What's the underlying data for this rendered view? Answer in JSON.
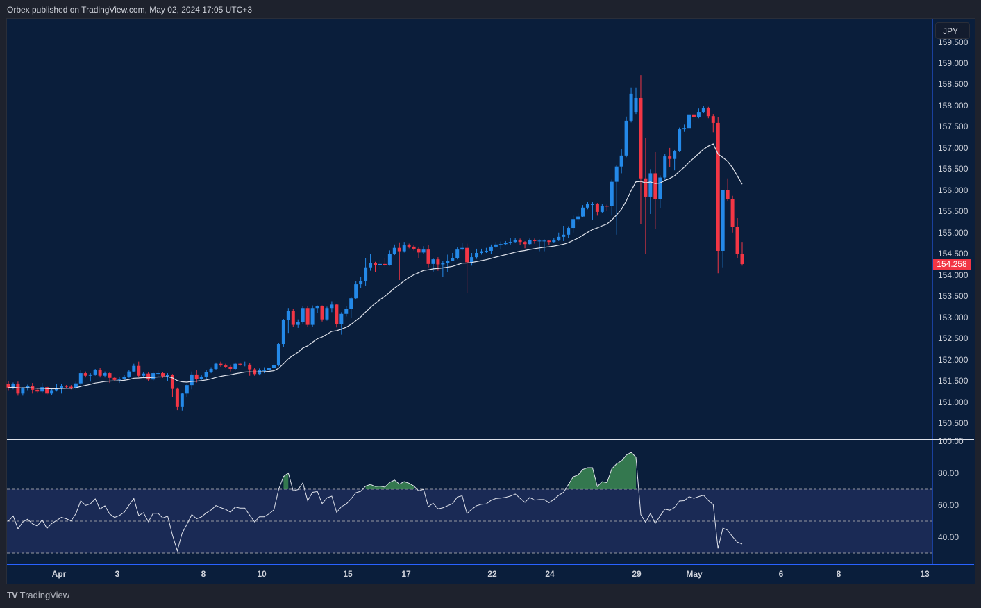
{
  "header": {
    "text": "Orbex published on TradingView.com, May 02, 2024 17:05 UTC+3"
  },
  "footer": {
    "brand": "TradingView",
    "logo_text": "TV"
  },
  "price_scale": {
    "currency": "JPY",
    "last_price": "154.258"
  },
  "colors": {
    "background": "#0a1e3b",
    "up": "#2489e8",
    "down": "#f23645",
    "ma_line": "#e0e3eb",
    "rsi_line": "#e0e3eb",
    "rsi_band": "#1a2a55",
    "rsi_overbought_fill": "#3f8f55",
    "last_price_label": "#f23645"
  },
  "chart_data": [
    {
      "type": "candlestick",
      "title": "",
      "y_ticks": [
        "159.500",
        "159.000",
        "158.500",
        "158.000",
        "157.500",
        "157.000",
        "156.500",
        "156.000",
        "155.500",
        "155.000",
        "154.500",
        "154.000",
        "153.500",
        "153.000",
        "152.500",
        "152.000",
        "151.500",
        "151.000",
        "150.500"
      ],
      "ylim": [
        150.3,
        159.55
      ],
      "x_ticks": [
        "Apr",
        "3",
        "8",
        "10",
        "15",
        "17",
        "22",
        "24",
        "29",
        "May",
        "6",
        "8",
        "13"
      ],
      "grid": false,
      "overlay": "moving average (white line)",
      "candles_ohlc": [
        [
          151.42,
          151.5,
          151.28,
          151.34
        ],
        [
          151.34,
          151.46,
          151.3,
          151.43
        ],
        [
          151.43,
          151.48,
          151.15,
          151.2
        ],
        [
          151.2,
          151.35,
          151.15,
          151.32
        ],
        [
          151.32,
          151.41,
          151.28,
          151.37
        ],
        [
          151.37,
          151.45,
          151.2,
          151.29
        ],
        [
          151.29,
          151.33,
          151.21,
          151.25
        ],
        [
          151.25,
          151.45,
          151.22,
          151.35
        ],
        [
          151.35,
          151.38,
          151.16,
          151.2
        ],
        [
          151.2,
          151.31,
          151.17,
          151.28
        ],
        [
          151.28,
          151.42,
          151.25,
          151.33
        ],
        [
          151.33,
          151.42,
          151.2,
          151.38
        ],
        [
          151.38,
          151.4,
          151.33,
          151.36
        ],
        [
          151.36,
          151.4,
          151.3,
          151.33
        ],
        [
          151.33,
          151.48,
          151.3,
          151.44
        ],
        [
          151.44,
          151.75,
          151.4,
          151.68
        ],
        [
          151.68,
          151.72,
          151.58,
          151.62
        ],
        [
          151.62,
          151.68,
          151.48,
          151.65
        ],
        [
          151.65,
          151.78,
          151.62,
          151.75
        ],
        [
          151.75,
          151.8,
          151.58,
          151.62
        ],
        [
          151.62,
          151.72,
          151.58,
          151.68
        ],
        [
          151.68,
          151.71,
          151.45,
          151.57
        ],
        [
          151.57,
          151.6,
          151.5,
          151.52
        ],
        [
          151.52,
          151.6,
          151.45,
          151.55
        ],
        [
          151.55,
          151.64,
          151.52,
          151.6
        ],
        [
          151.6,
          151.75,
          151.57,
          151.72
        ],
        [
          151.72,
          151.9,
          151.7,
          151.85
        ],
        [
          151.85,
          151.95,
          151.58,
          151.62
        ],
        [
          151.62,
          151.7,
          151.58,
          151.67
        ],
        [
          151.67,
          151.7,
          151.5,
          151.53
        ],
        [
          151.53,
          151.72,
          151.5,
          151.68
        ],
        [
          151.68,
          151.74,
          151.6,
          151.68
        ],
        [
          151.68,
          151.7,
          151.57,
          151.61
        ],
        [
          151.61,
          151.68,
          151.5,
          151.64
        ],
        [
          151.64,
          151.66,
          151.11,
          151.31
        ],
        [
          151.31,
          151.34,
          150.81,
          150.88
        ],
        [
          150.88,
          151.22,
          150.8,
          151.2
        ],
        [
          151.2,
          151.42,
          151.12,
          151.4
        ],
        [
          151.4,
          151.72,
          151.3,
          151.65
        ],
        [
          151.65,
          151.75,
          151.46,
          151.55
        ],
        [
          151.55,
          151.63,
          151.52,
          151.6
        ],
        [
          151.6,
          151.76,
          151.55,
          151.7
        ],
        [
          151.7,
          151.82,
          151.68,
          151.78
        ],
        [
          151.78,
          151.93,
          151.75,
          151.9
        ],
        [
          151.9,
          151.95,
          151.83,
          151.86
        ],
        [
          151.86,
          151.9,
          151.8,
          151.83
        ],
        [
          151.83,
          151.88,
          151.72,
          151.78
        ],
        [
          151.78,
          151.93,
          151.75,
          151.9
        ],
        [
          151.9,
          151.93,
          151.85,
          151.88
        ],
        [
          151.88,
          151.95,
          151.84,
          151.88
        ],
        [
          151.88,
          151.91,
          151.62,
          151.77
        ],
        [
          151.77,
          151.8,
          151.62,
          151.66
        ],
        [
          151.66,
          151.79,
          151.63,
          151.75
        ],
        [
          151.75,
          151.82,
          151.68,
          151.75
        ],
        [
          151.75,
          151.84,
          151.71,
          151.8
        ],
        [
          151.8,
          151.93,
          151.76,
          151.87
        ],
        [
          151.87,
          152.4,
          151.84,
          152.37
        ],
        [
          152.37,
          152.96,
          152.3,
          152.93
        ],
        [
          152.93,
          153.22,
          152.63,
          153.15
        ],
        [
          153.15,
          153.2,
          152.78,
          152.82
        ],
        [
          152.82,
          152.95,
          152.75,
          152.88
        ],
        [
          152.88,
          153.27,
          152.85,
          153.22
        ],
        [
          153.22,
          153.26,
          152.77,
          152.82
        ],
        [
          152.82,
          153.28,
          152.78,
          153.22
        ],
        [
          153.22,
          153.28,
          153.1,
          153.26
        ],
        [
          153.26,
          153.28,
          152.9,
          152.95
        ],
        [
          152.95,
          153.25,
          152.92,
          153.22
        ],
        [
          153.22,
          153.38,
          153.12,
          153.3
        ],
        [
          153.3,
          153.32,
          152.76,
          152.83
        ],
        [
          152.83,
          153.12,
          152.59,
          153.08
        ],
        [
          153.08,
          153.27,
          153.02,
          153.2
        ],
        [
          153.2,
          153.48,
          152.98,
          153.45
        ],
        [
          153.45,
          153.85,
          153.42,
          153.78
        ],
        [
          153.78,
          153.95,
          153.7,
          153.86
        ],
        [
          153.86,
          154.4,
          153.75,
          154.18
        ],
        [
          154.18,
          154.5,
          154.1,
          154.29
        ],
        [
          154.29,
          154.31,
          154.06,
          154.24
        ],
        [
          154.24,
          154.36,
          154.14,
          154.26
        ],
        [
          154.26,
          154.4,
          154.2,
          154.24
        ],
        [
          154.24,
          154.58,
          154.22,
          154.5
        ],
        [
          154.5,
          154.72,
          154.47,
          154.64
        ],
        [
          154.64,
          154.77,
          153.88,
          154.56
        ],
        [
          154.56,
          154.78,
          154.53,
          154.7
        ],
        [
          154.7,
          154.74,
          154.63,
          154.67
        ],
        [
          154.67,
          154.7,
          154.58,
          154.62
        ],
        [
          154.62,
          154.65,
          154.4,
          154.53
        ],
        [
          154.53,
          154.68,
          154.5,
          154.6
        ],
        [
          154.6,
          154.7,
          154.18,
          154.26
        ],
        [
          154.26,
          154.4,
          154.08,
          154.37
        ],
        [
          154.37,
          154.42,
          154.1,
          154.25
        ],
        [
          154.25,
          154.33,
          153.95,
          154.28
        ],
        [
          154.28,
          154.48,
          154.07,
          154.34
        ],
        [
          154.34,
          154.52,
          154.33,
          154.4
        ],
        [
          154.4,
          154.65,
          154.37,
          154.6
        ],
        [
          154.6,
          154.75,
          154.58,
          154.64
        ],
        [
          154.64,
          154.74,
          153.58,
          154.3
        ],
        [
          154.3,
          154.52,
          154.22,
          154.42
        ],
        [
          154.42,
          154.62,
          154.38,
          154.52
        ],
        [
          154.52,
          154.62,
          154.48,
          154.56
        ],
        [
          154.56,
          154.64,
          154.52,
          154.57
        ],
        [
          154.57,
          154.72,
          154.5,
          154.67
        ],
        [
          154.67,
          154.78,
          154.64,
          154.72
        ],
        [
          154.72,
          154.79,
          154.6,
          154.73
        ],
        [
          154.73,
          154.8,
          154.7,
          154.75
        ],
        [
          154.75,
          154.88,
          154.72,
          154.78
        ],
        [
          154.78,
          154.88,
          154.75,
          154.83
        ],
        [
          154.83,
          154.86,
          154.7,
          154.78
        ],
        [
          154.78,
          154.8,
          154.63,
          154.73
        ],
        [
          154.73,
          154.86,
          154.7,
          154.83
        ],
        [
          154.83,
          154.86,
          154.74,
          154.8
        ],
        [
          154.8,
          154.84,
          154.56,
          154.81
        ],
        [
          154.81,
          154.84,
          154.56,
          154.81
        ],
        [
          154.81,
          154.83,
          154.7,
          154.78
        ],
        [
          154.78,
          154.88,
          154.75,
          154.83
        ],
        [
          154.83,
          155.0,
          154.8,
          154.9
        ],
        [
          154.9,
          155.16,
          154.8,
          154.95
        ],
        [
          154.95,
          155.15,
          154.88,
          155.11
        ],
        [
          155.11,
          155.4,
          155.0,
          155.32
        ],
        [
          155.32,
          155.45,
          155.25,
          155.38
        ],
        [
          155.38,
          155.65,
          155.36,
          155.59
        ],
        [
          155.59,
          155.73,
          155.55,
          155.67
        ],
        [
          155.67,
          155.73,
          155.3,
          155.67
        ],
        [
          155.67,
          155.7,
          155.4,
          155.49
        ],
        [
          155.49,
          155.68,
          155.46,
          155.63
        ],
        [
          155.63,
          155.66,
          155.52,
          155.62
        ],
        [
          155.62,
          156.25,
          155.4,
          156.2
        ],
        [
          156.2,
          156.6,
          154.95,
          156.56
        ],
        [
          156.56,
          156.98,
          156.4,
          156.82
        ],
        [
          156.82,
          157.74,
          156.78,
          157.64
        ],
        [
          157.64,
          158.43,
          157.6,
          158.28
        ],
        [
          157.85,
          158.43,
          157.8,
          158.18
        ],
        [
          158.18,
          158.72,
          155.2,
          156.28
        ],
        [
          156.28,
          157.23,
          154.5,
          155.85
        ],
        [
          155.85,
          156.5,
          155.44,
          156.4
        ],
        [
          156.4,
          156.9,
          155.08,
          155.8
        ],
        [
          155.8,
          156.35,
          155.57,
          156.3
        ],
        [
          156.3,
          156.85,
          156.25,
          156.8
        ],
        [
          156.8,
          157.0,
          156.54,
          156.74
        ],
        [
          156.74,
          156.95,
          156.47,
          156.93
        ],
        [
          156.93,
          157.48,
          156.9,
          157.44
        ],
        [
          157.44,
          157.55,
          157.38,
          157.47
        ],
        [
          157.47,
          157.85,
          157.45,
          157.79
        ],
        [
          157.79,
          157.83,
          157.62,
          157.72
        ],
        [
          157.72,
          157.93,
          157.7,
          157.85
        ],
        [
          157.85,
          157.99,
          157.83,
          157.95
        ],
        [
          157.95,
          157.97,
          157.7,
          157.75
        ],
        [
          157.75,
          157.8,
          157.37,
          157.59
        ],
        [
          157.59,
          157.73,
          154.04,
          154.57
        ],
        [
          154.57,
          156.01,
          154.18,
          156.01
        ],
        [
          156.01,
          156.28,
          155.75,
          155.8
        ],
        [
          155.8,
          155.87,
          155.0,
          155.13
        ],
        [
          155.13,
          155.34,
          154.39,
          154.49
        ],
        [
          154.49,
          154.78,
          154.22,
          154.258
        ]
      ]
    },
    {
      "type": "line",
      "title": "",
      "indicator": "RSI",
      "y_ticks": [
        "100.00",
        "80.00",
        "60.00",
        "40.00"
      ],
      "ylim": [
        20,
        100
      ],
      "levels": [
        70,
        50,
        30
      ],
      "band": [
        30,
        70
      ]
    }
  ]
}
